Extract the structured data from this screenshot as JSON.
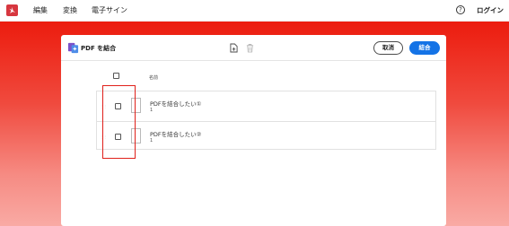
{
  "nav": {
    "items": [
      "編集",
      "変換",
      "電子サイン"
    ],
    "help_icon": "?",
    "login": "ログイン"
  },
  "card": {
    "title": "PDF を結合",
    "cancel_label": "取消",
    "combine_label": "結合"
  },
  "list": {
    "name_header": "名前",
    "files": [
      {
        "name": "PDFを結合したい①",
        "pages": "1"
      },
      {
        "name": "PDFを結合したい②",
        "pages": "1"
      }
    ]
  },
  "colors": {
    "brand_red": "#d7373f",
    "hero_red": "#ec1c0e",
    "primary_blue": "#1473e6",
    "highlight_red": "#e0201a"
  },
  "icons": {
    "logo": "acrobat-logo-icon",
    "combine": "combine-files-icon",
    "add_file": "add-file-icon",
    "trash": "trash-icon",
    "help": "help-icon"
  }
}
